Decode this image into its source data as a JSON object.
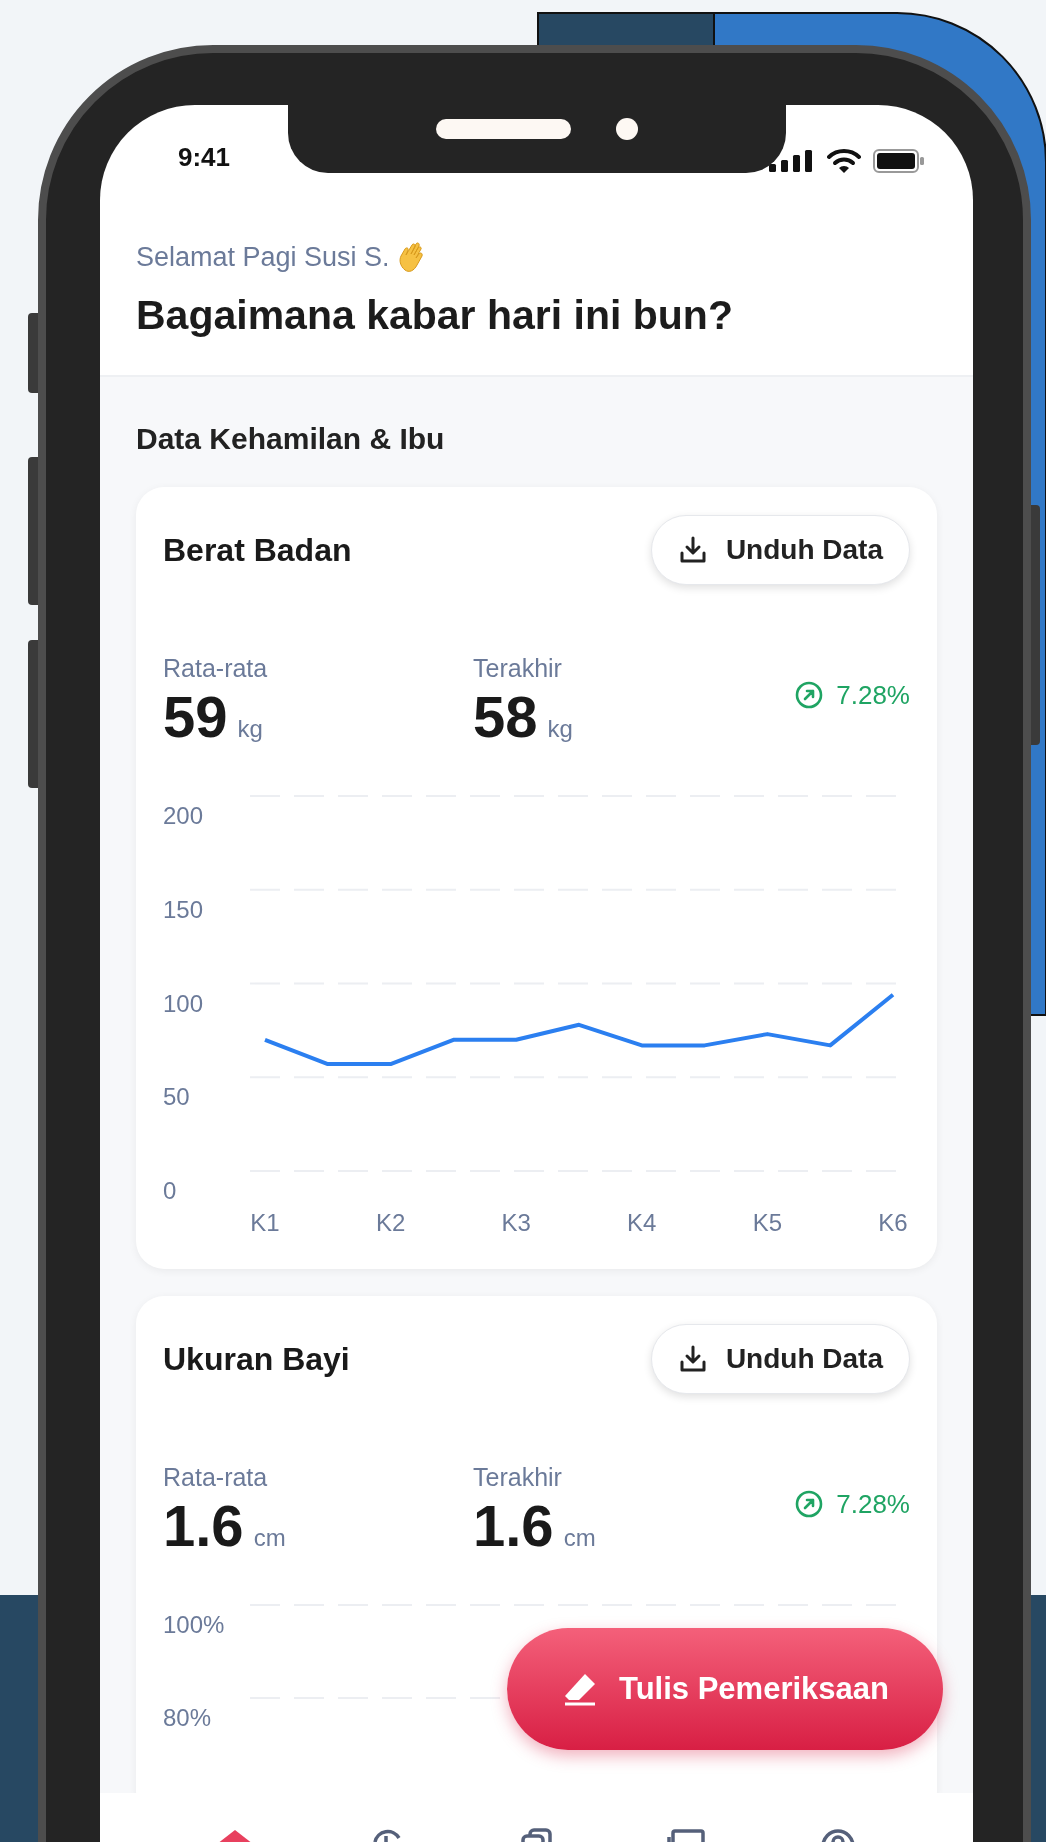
{
  "status_bar": {
    "time": "9:41"
  },
  "header": {
    "greeting": "Selamat Pagi Susi S.",
    "title": "Bagaimana kabar hari ini bun?"
  },
  "section_title": "Data Kehamilan & Ibu",
  "cards": [
    {
      "title": "Berat Badan",
      "button": "Unduh Data",
      "stats": [
        {
          "label": "Rata-rata",
          "value": "59",
          "unit": "kg"
        },
        {
          "label": "Terakhir",
          "value": "58",
          "unit": "kg"
        }
      ],
      "change": "7.28%",
      "chart_data": {
        "type": "line",
        "categories": [
          "K1",
          null,
          "K2",
          null,
          "K3",
          null,
          "K4",
          null,
          "K5",
          null,
          "K6"
        ],
        "series": [
          {
            "color": "#2b7ff0",
            "values": [
              70,
              57,
              57,
              70,
              70,
              78,
              67,
              67,
              73,
              67,
              94
            ]
          }
        ],
        "ylim": [
          0,
          200
        ],
        "yticks": [
          0,
          50,
          100,
          150,
          200
        ],
        "grid": true
      }
    },
    {
      "title": "Ukuran Bayi",
      "button": "Unduh Data",
      "stats": [
        {
          "label": "Rata-rata",
          "value": "1.6",
          "unit": "cm"
        },
        {
          "label": "Terakhir",
          "value": "1.6",
          "unit": "cm"
        }
      ],
      "change": "7.28%",
      "y_labels": [
        "100%",
        "80%"
      ]
    }
  ],
  "fab": {
    "label": "Tulis Pemeriksaan"
  },
  "bottom_nav": [
    {
      "kind": "home",
      "selected": true
    },
    {
      "kind": "history",
      "selected": false
    },
    {
      "kind": "documents",
      "selected": false
    },
    {
      "kind": "screen",
      "selected": false
    },
    {
      "kind": "profile",
      "selected": false
    }
  ]
}
